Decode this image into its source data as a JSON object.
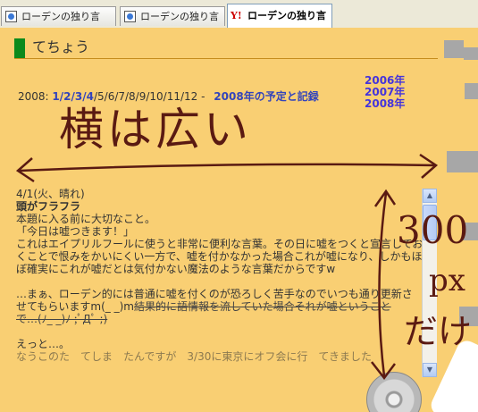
{
  "browser": {
    "tabs": [
      {
        "label": "ローデンの独り言"
      },
      {
        "label": "ローデンの独り言"
      },
      {
        "label": "ローデンの独り言"
      }
    ]
  },
  "page": {
    "title": "てちょう",
    "year_prefix": "2008:",
    "months_current": "1/2/3/4",
    "months_rest": "/5/6/7/8/9/10/11/12",
    "separator": "-",
    "plan_link": "2008年の予定と記録",
    "year_links": [
      "2006年",
      "2007年",
      "2008年"
    ]
  },
  "entry": {
    "date": "4/1(火、晴れ)",
    "title": "頭がフラフラ",
    "lines": [
      "本題に入る前に大切なこと。",
      "「今日は嘘つきます！」",
      "これはエイプリルフールに使うと非常に便利な言葉。その日に嘘をつくと宣言してお",
      "くことで恨みをかいにくい一方で、嘘を付かなかった場合これが嘘になり、しかもほ",
      "ぼ確実にこれが嘘だとは気付かない魔法のような言葉だからですw",
      "",
      "…まぁ、ローデン的には普通に嘘を付くのが恐ろしく苦手なのでいつも通り更新さ",
      "せてもらいますm(_ _)m"
    ],
    "strike_a": "結果的に語情報を流していた場合それが嘘ということ",
    "strike_b": "で…(ﾉ_ _)ﾉ ;ﾟДﾟ ;)",
    "after": [
      "",
      "えっと…。",
      "なうこのた　てしま　たんですが　3/30に東京にオフ会に行　てきました"
    ]
  },
  "annotations": {
    "wide_label": "横は広い",
    "px_value": "300",
    "px_unit": "px",
    "only_label": "だけ"
  },
  "scrollbar": {
    "up": "▲",
    "down": "▼"
  },
  "colors": {
    "background": "#f9cf73",
    "accent_green": "#0c8a1c",
    "link_blue": "#3344bb",
    "ink": "#5a1a12"
  }
}
